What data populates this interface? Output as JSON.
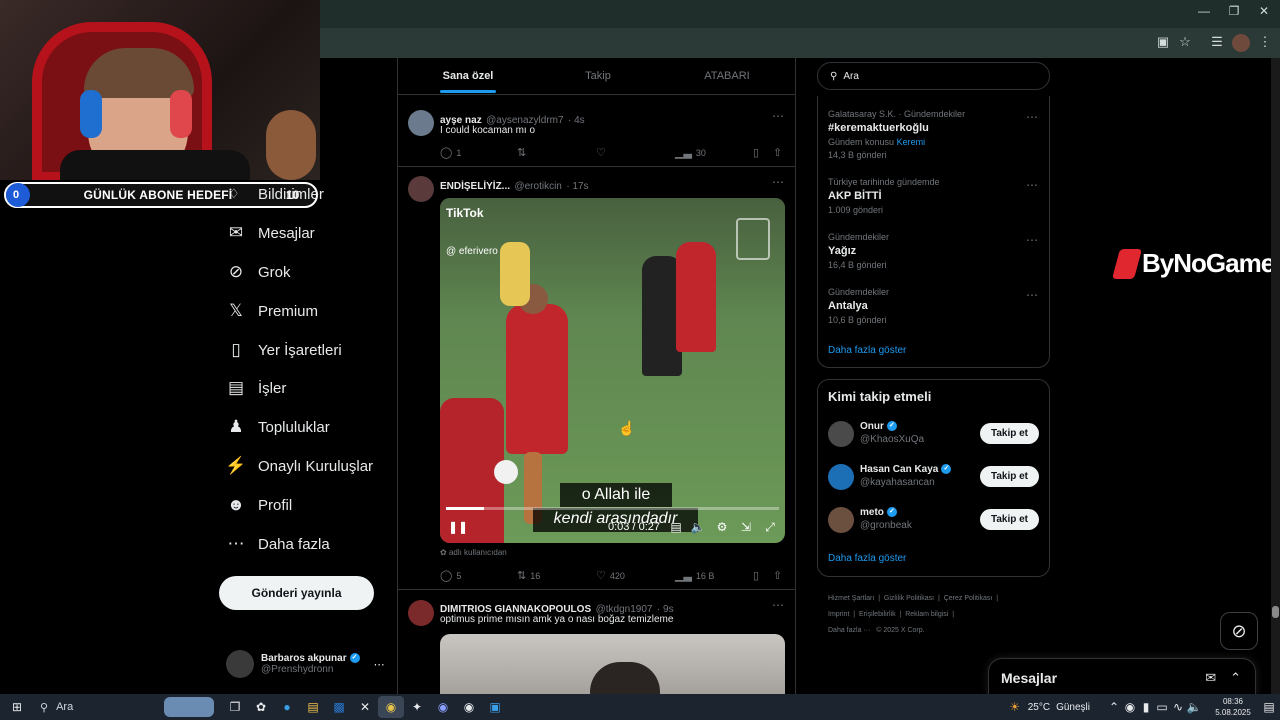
{
  "overlay": {
    "subgoal_count": "0",
    "subgoal_title": "GÜNLÜK ABONE HEDEFİ",
    "subgoal_target": "10",
    "sponsor": "ByNoGame"
  },
  "nav": {
    "items": [
      {
        "label": "Bildirimler",
        "icon": "bell-icon"
      },
      {
        "label": "Mesajlar",
        "icon": "mail-icon"
      },
      {
        "label": "Grok",
        "icon": "grok-icon"
      },
      {
        "label": "Premium",
        "icon": "x-logo-icon"
      },
      {
        "label": "Yer İşaretleri",
        "icon": "bookmark-icon"
      },
      {
        "label": "İşler",
        "icon": "briefcase-icon"
      },
      {
        "label": "Topluluklar",
        "icon": "people-icon"
      },
      {
        "label": "Onaylı Kuruluşlar",
        "icon": "lightning-icon"
      },
      {
        "label": "Profil",
        "icon": "person-icon"
      },
      {
        "label": "Daha fazla",
        "icon": "more-circle-icon"
      }
    ],
    "post_button": "Gönderi yayınla",
    "account_name": "Barbaros akpunar",
    "account_handle": "@Prenshydronn"
  },
  "timeline": {
    "tabs": [
      "Sana özel",
      "Takip",
      "ATABARI"
    ],
    "posts": [
      {
        "name": "ayşe naz",
        "handle": "@aysenazyldrm7",
        "time": "· 4s",
        "text": "I could kocaman mı o",
        "replies": "1",
        "reposts": "",
        "likes": "",
        "views": "30"
      },
      {
        "name": "ENDİŞELİYİZ...",
        "handle": "@erotikcin",
        "time": "· 17s",
        "video_watermark": "TikTok",
        "video_user": "@ eferivero",
        "caption_line1": "o Allah ile",
        "caption_line2": "kendi arasındadır",
        "video_time": "0:03 / 0:27",
        "note": "adlı kullanıcıdan",
        "replies": "5",
        "reposts": "16",
        "likes": "420",
        "views": "16 B"
      },
      {
        "name": "DIMITRIOS GIANNAKOPOULOS",
        "handle": "@tkdgn1907",
        "time": "· 9s",
        "text": "optimus prime mısın amk ya o nası boğaz temizleme"
      }
    ]
  },
  "search": {
    "value": "Ara"
  },
  "trends": {
    "items": [
      {
        "meta": "Galatasaray S.K. · Gündemdekiler",
        "title": "#keremaktuerkoğlu",
        "sub": "Gündem konusu",
        "sub_link": "Keremi",
        "count": "14,3 B gönderi"
      },
      {
        "meta": "Türkiye tarihinde gündemde",
        "title": "AKP BİTTİ",
        "count": "1.009 gönderi"
      },
      {
        "meta": "Gündemdekiler",
        "title": "Yağız",
        "count": "16,4 B gönderi"
      },
      {
        "meta": "Gündemdekiler",
        "title": "Antalya",
        "count": "10,6 B gönderi"
      }
    ],
    "show_more": "Daha fazla göster"
  },
  "who_to_follow": {
    "title": "Kimi takip etmeli",
    "users": [
      {
        "name": "Onur",
        "handle": "@KhaosXuQa",
        "button": "Takip et"
      },
      {
        "name": "Hasan Can Kaya",
        "handle": "@kayahasancan",
        "button": "Takip et"
      },
      {
        "name": "meto",
        "handle": "@gronbeak",
        "button": "Takip et"
      }
    ],
    "show_more": "Daha fazla göster"
  },
  "footer": {
    "links": [
      "Hizmet Şartları",
      "|",
      "Gizlilik Politikası",
      "|",
      "Çerez Politikası",
      "|",
      "Imprint",
      "|",
      "Erişilebilirlik",
      "|",
      "Reklam bilgisi",
      "|"
    ],
    "more": "Daha fazla ···",
    "copyright": "© 2025 X Corp."
  },
  "messages_drawer": {
    "title": "Mesajlar"
  },
  "taskbar": {
    "search": "Ara",
    "weather": "25°C",
    "weather_desc": "Güneşli",
    "time": "08:36",
    "date": "5.08.2025"
  },
  "colors": {
    "accent": "#1d9bf0",
    "background": "#000000",
    "border": "#2f3336"
  }
}
